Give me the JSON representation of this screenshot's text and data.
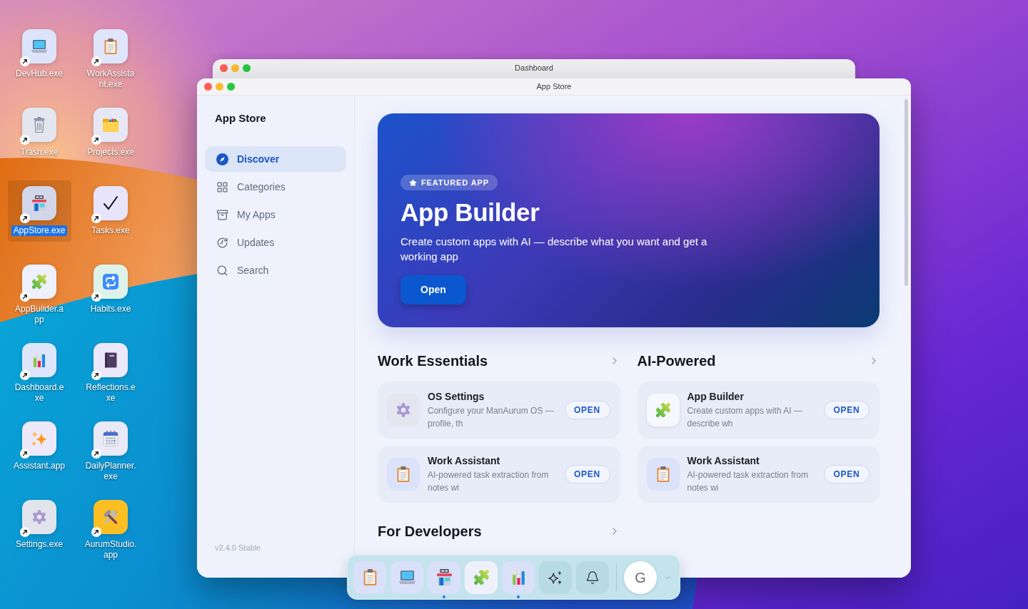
{
  "desktop_icons": [
    {
      "kind": "laptop",
      "label": "DevHub.exe",
      "selected": false
    },
    {
      "kind": "clipboard",
      "label": "WorkAssistant.exe",
      "selected": false
    },
    {
      "kind": "trash",
      "label": "Trash.exe",
      "selected": false
    },
    {
      "kind": "folder",
      "label": "Projects.exe",
      "selected": false
    },
    {
      "kind": "store",
      "label": "AppStore.exe",
      "selected": true
    },
    {
      "kind": "check",
      "label": "Tasks.exe",
      "selected": false
    },
    {
      "kind": "puzzle",
      "label": "AppBuilder.app",
      "selected": false
    },
    {
      "kind": "repeat",
      "label": "Habits.exe",
      "selected": false
    },
    {
      "kind": "chart",
      "label": "Dashboard.exe",
      "selected": false
    },
    {
      "kind": "book",
      "label": "Reflections.exe",
      "selected": false
    },
    {
      "kind": "sparkles",
      "label": "Assistant.app",
      "selected": false
    },
    {
      "kind": "calendar",
      "label": "DailyPlanner.exe",
      "selected": false
    },
    {
      "kind": "gear",
      "label": "Settings.exe",
      "selected": false
    },
    {
      "kind": "tools",
      "label": "AurumStudio.app",
      "selected": false
    }
  ],
  "background_window": {
    "title": "Dashboard"
  },
  "window": {
    "title": "App Store",
    "sidebar": {
      "title": "App Store",
      "items": [
        {
          "kind": "compass",
          "label": "Discover",
          "selected": true
        },
        {
          "kind": "grid",
          "label": "Categories",
          "selected": false
        },
        {
          "kind": "archive",
          "label": "My Apps",
          "selected": false
        },
        {
          "kind": "updates",
          "label": "Updates",
          "selected": false
        },
        {
          "kind": "search",
          "label": "Search",
          "selected": false
        }
      ],
      "version": "v2.4.0 Stable"
    },
    "featured": {
      "badge": "FEATURED APP",
      "title": "App Builder",
      "description": "Create custom apps with AI — describe what you want and get a working app",
      "button": "Open"
    },
    "sections": [
      {
        "title": "Work Essentials",
        "apps": [
          {
            "kind": "gear",
            "name": "OS Settings",
            "description": "Configure your ManAurum OS — profile, th",
            "button": "OPEN"
          },
          {
            "kind": "clipboard",
            "name": "Work Assistant",
            "description": "AI-powered task extraction from notes wi",
            "button": "OPEN"
          }
        ]
      },
      {
        "title": "AI-Powered",
        "apps": [
          {
            "kind": "puzzle",
            "name": "App Builder",
            "description": "Create custom apps with AI — describe wh",
            "button": "OPEN"
          },
          {
            "kind": "clipboard",
            "name": "Work Assistant",
            "description": "AI-powered task extraction from notes wi",
            "button": "OPEN"
          }
        ]
      },
      {
        "title": "For Developers"
      }
    ]
  },
  "dock": {
    "items": [
      {
        "kind": "clipboard",
        "active": false,
        "running": false
      },
      {
        "kind": "laptop",
        "active": false,
        "running": false
      },
      {
        "kind": "store",
        "active": false,
        "running": true
      },
      {
        "kind": "puzzle",
        "active": true,
        "running": false
      },
      {
        "kind": "chart",
        "active": false,
        "running": true
      },
      {
        "kind": "assistant",
        "active": false,
        "running": false
      },
      {
        "kind": "notifications",
        "active": false,
        "running": false
      }
    ],
    "avatar": {
      "initial": "G"
    }
  }
}
